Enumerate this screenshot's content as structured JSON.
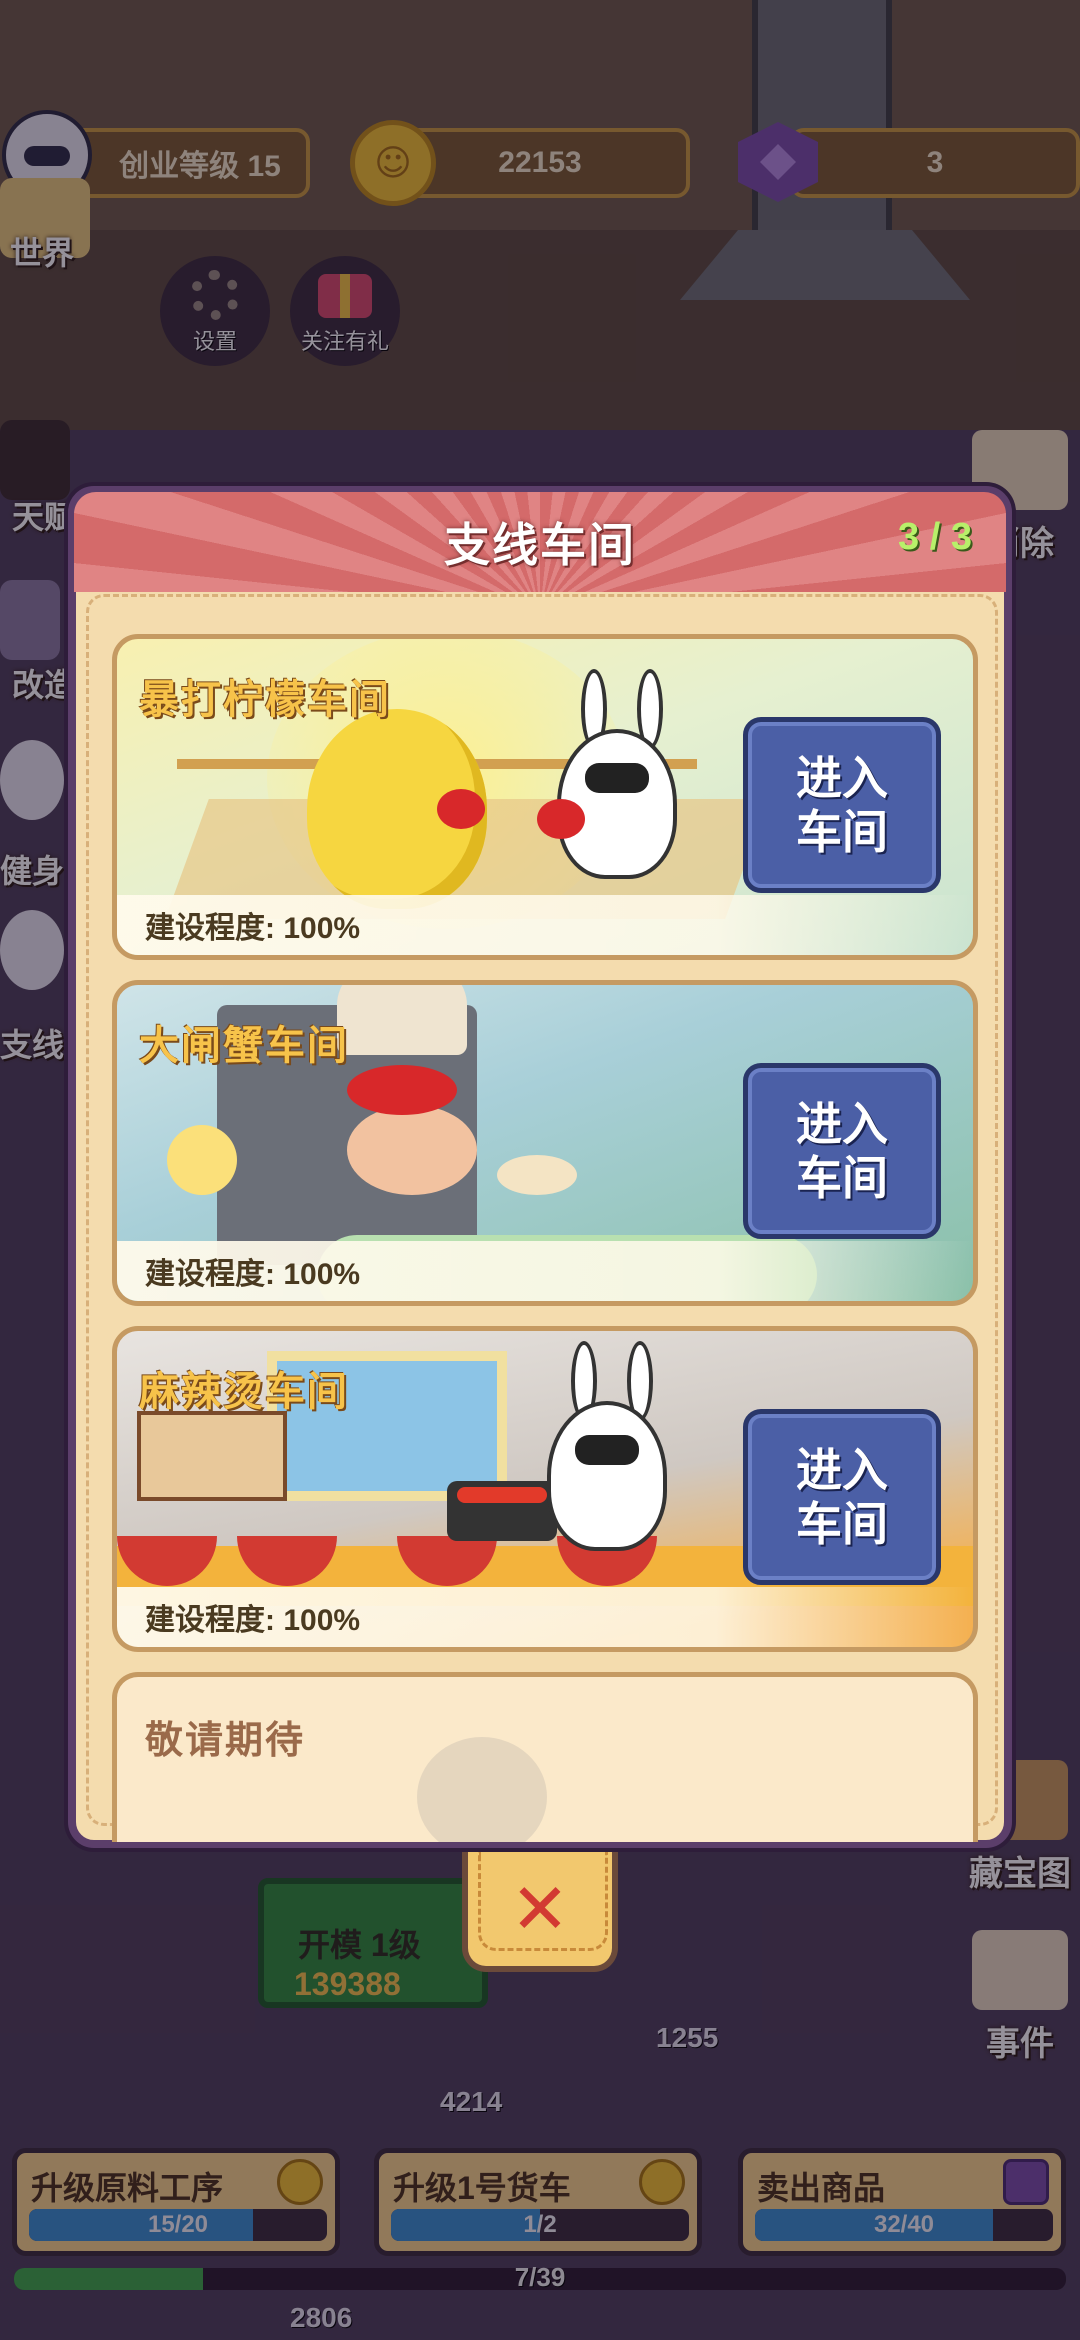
{
  "hud": {
    "level_label": "创业等级 15",
    "gold": "22153",
    "gems": "3"
  },
  "left_menu": {
    "world": "世界",
    "settings": "设置",
    "follow_gift": "关注有礼",
    "item_2": "天赋",
    "item_3": "改造",
    "item_4": "健身",
    "item_5": "支线"
  },
  "right_menu": {
    "item_1": "消除",
    "treasure_map": "藏宝图",
    "events": "事件"
  },
  "modal": {
    "title": "支线车间",
    "count": "3 / 3",
    "workshops": [
      {
        "name": "暴打柠檬车间",
        "progress": "建设程度: 100%",
        "button": "进入车间"
      },
      {
        "name": "大闸蟹车间",
        "progress": "建设程度: 100%",
        "button": "进入车间"
      },
      {
        "name": "麻辣烫车间",
        "progress": "建设程度: 100%",
        "button": "进入车间"
      }
    ],
    "coming_soon": "敬请期待",
    "close_symbol": "✕"
  },
  "scene": {
    "sign_row1": "开模    1级",
    "sign_row2": "139388",
    "float_1": "1255",
    "float_2": "4214",
    "float_3": "2806"
  },
  "tasks": [
    {
      "label": "升级原料工序",
      "progress_text": "15/20",
      "progress": 0.75,
      "icon": "coin-icon"
    },
    {
      "label": "升级1号货车",
      "progress_text": "1/2",
      "progress": 0.5,
      "icon": "coin-icon"
    },
    {
      "label": "卖出商品",
      "progress_text": "32/40",
      "progress": 0.8,
      "icon": "gem-icon"
    }
  ],
  "overall_progress": {
    "text": "7/39",
    "value": 0.18
  },
  "colors": {
    "enter_button": "#4b5fa6",
    "title_gold": "#f7c34a",
    "count_green": "#b8f06a",
    "header_red": "#d46a6a"
  }
}
